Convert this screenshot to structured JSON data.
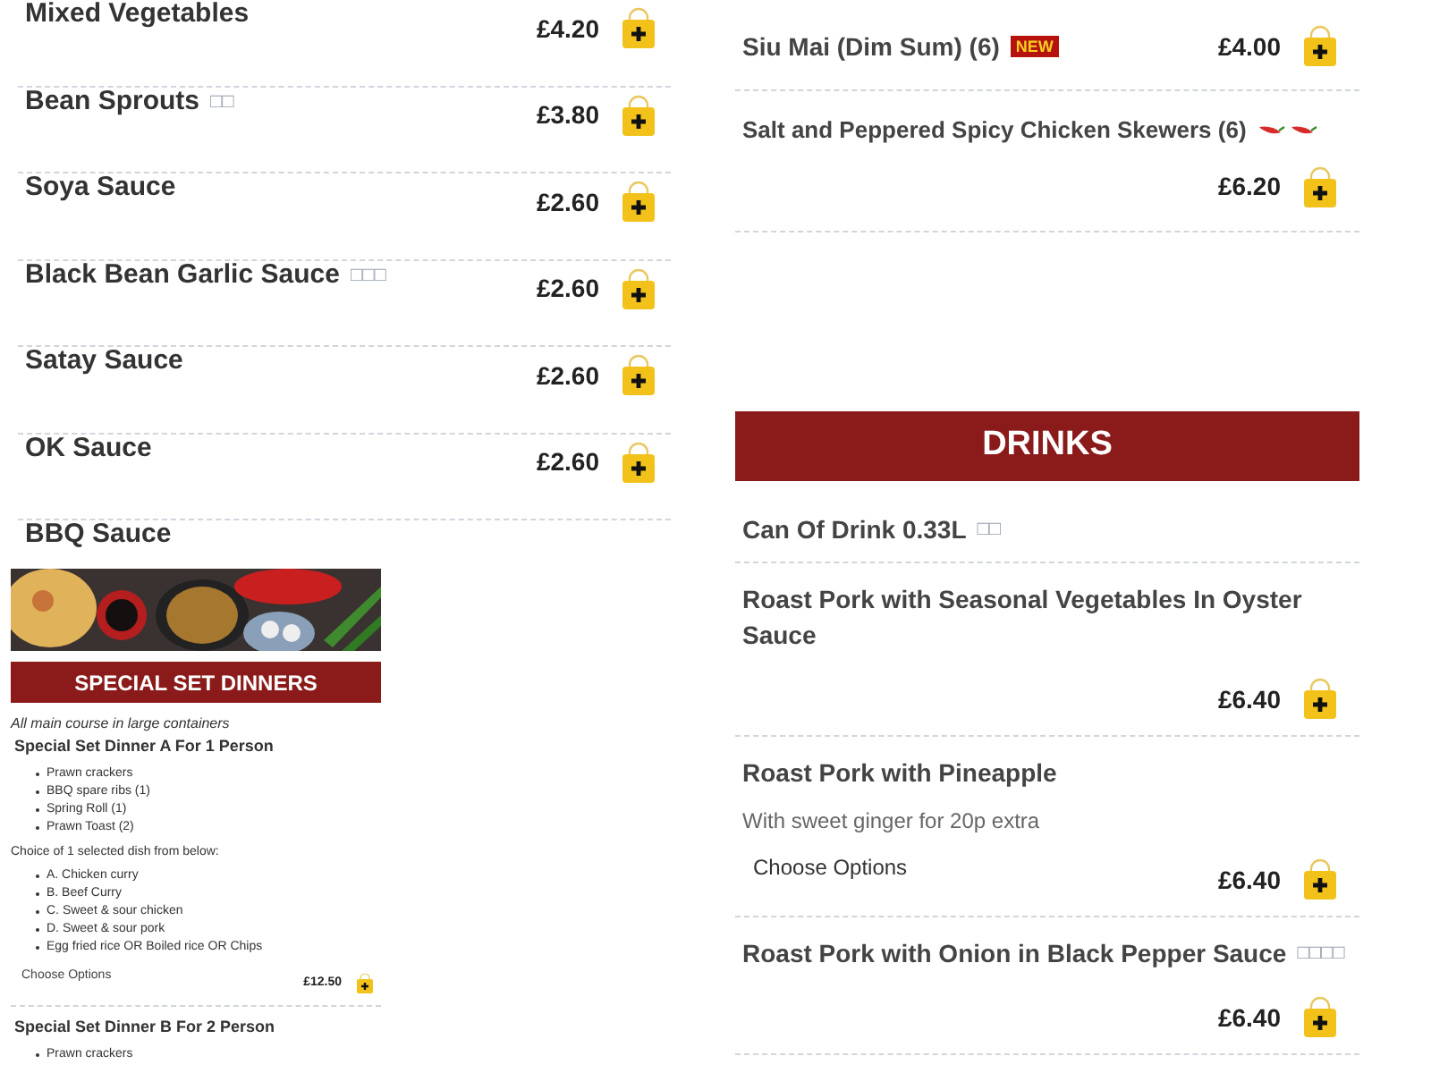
{
  "left_menu": {
    "items": [
      {
        "name": "Mixed Vegetables",
        "price": "£4.20"
      },
      {
        "name": "Bean Sprouts",
        "glyphs": "□□",
        "price": "£3.80"
      },
      {
        "name": "Soya Sauce",
        "price": "£2.60"
      },
      {
        "name": "Black Bean Garlic Sauce",
        "glyphs": "□□□",
        "price": "£2.60"
      },
      {
        "name": "Satay Sauce",
        "price": "£2.60"
      },
      {
        "name": "OK Sauce",
        "price": "£2.60"
      },
      {
        "name": "BBQ Sauce"
      }
    ]
  },
  "right_menu": {
    "items": [
      {
        "name": "Siu Mai (Dim Sum) (6)",
        "badge": "NEW",
        "price": "£4.00",
        "spicy": false
      },
      {
        "name": "Salt and Peppered Spicy Chicken Skewers (6)",
        "price": "£6.20",
        "spicy": true
      }
    ],
    "section_title": "DRINKS"
  },
  "drinks_menu": {
    "items": [
      {
        "name": "Can Of Drink 0.33L",
        "glyphs": "□□"
      },
      {
        "name": "Roast Pork with Seasonal Vegetables In Oyster Sauce",
        "price": "£6.40"
      },
      {
        "name": "Roast Pork with Pineapple",
        "description": "With sweet ginger for 20p extra",
        "options": "Choose Options",
        "price": "£6.40"
      },
      {
        "name": "Roast Pork with Onion in Black Pepper Sauce",
        "glyphs": "□□□□",
        "price": "£6.40"
      }
    ]
  },
  "set_dinners": {
    "kind": "picture",
    "title": "SPECIAL SET DINNERS",
    "note": "All main course in large containers",
    "items": [
      {
        "name": "Special Set Dinner A For 1 Person",
        "lines": [
          "Prawn crackers",
          "BBQ spare ribs (1)",
          "Spring Roll (1)",
          "Prawn Toast (2)"
        ],
        "choice_label": "Choice of 1 selected dish from below:",
        "choices": [
          "A. Chicken curry",
          "B. Beef Curry",
          "C. Sweet & sour chicken",
          "D. Sweet & sour pork",
          "Egg fried rice OR Boiled rice OR Chips"
        ],
        "options": "Choose Options",
        "price": "£12.50"
      },
      {
        "name": "Special Set Dinner B For 2 Person",
        "lines": [
          "Prawn crackers"
        ]
      }
    ]
  }
}
